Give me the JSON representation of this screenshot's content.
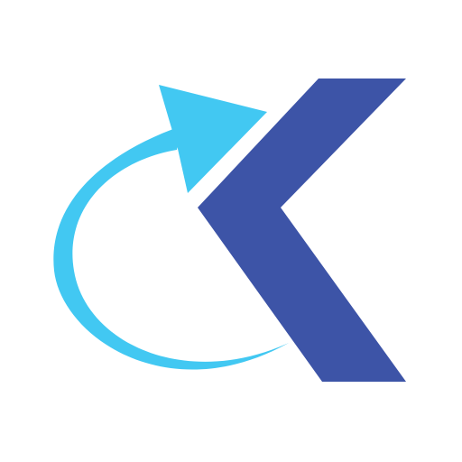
{
  "logo": {
    "colors": {
      "background": "#ffffff",
      "letter": "#3d54a7",
      "arrow": "#42c8f2"
    },
    "icons": {
      "letter": "k-letter-icon",
      "arrow": "curved-arrow-icon"
    }
  }
}
